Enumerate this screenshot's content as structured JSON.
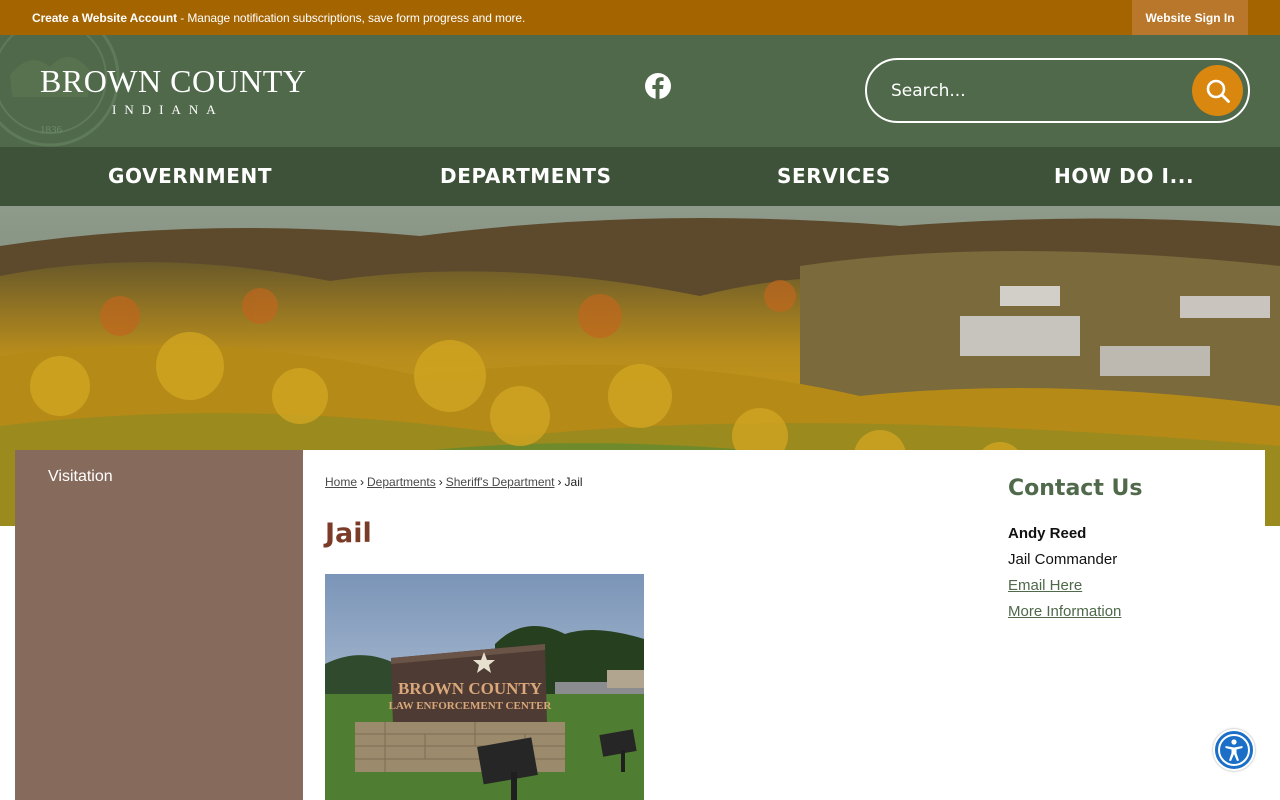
{
  "topbar": {
    "create_account": "Create a Website Account",
    "message": " - Manage notification subscriptions, save form progress and more.",
    "signin": "Website Sign In"
  },
  "header": {
    "logo_main": "BROWN COUNTY",
    "logo_sub": "INDIANA",
    "seal_year": "1836",
    "search_placeholder": "Search..."
  },
  "nav": {
    "items": [
      "GOVERNMENT",
      "DEPARTMENTS",
      "SERVICES",
      "HOW DO I..."
    ]
  },
  "sidebar": {
    "items": [
      "Visitation"
    ]
  },
  "breadcrumb": {
    "home": "Home",
    "departments": "Departments",
    "sheriff": "Sheriff's Department",
    "current": "Jail",
    "sep": "›"
  },
  "page": {
    "title": "Jail",
    "sign_line1": "BROWN COUNTY",
    "sign_line2": "LAW ENFORCEMENT CENTER"
  },
  "contact": {
    "heading": "Contact Us",
    "name": "Andy Reed",
    "role": "Jail Commander",
    "email_link": "Email Here",
    "more_link": "More Information"
  },
  "colors": {
    "topbar": "#a46400",
    "header": "#4f694a",
    "nav": "#3d5238",
    "sidebar": "#866b5c",
    "title": "#7a3c28",
    "search_button": "#d9870f"
  }
}
